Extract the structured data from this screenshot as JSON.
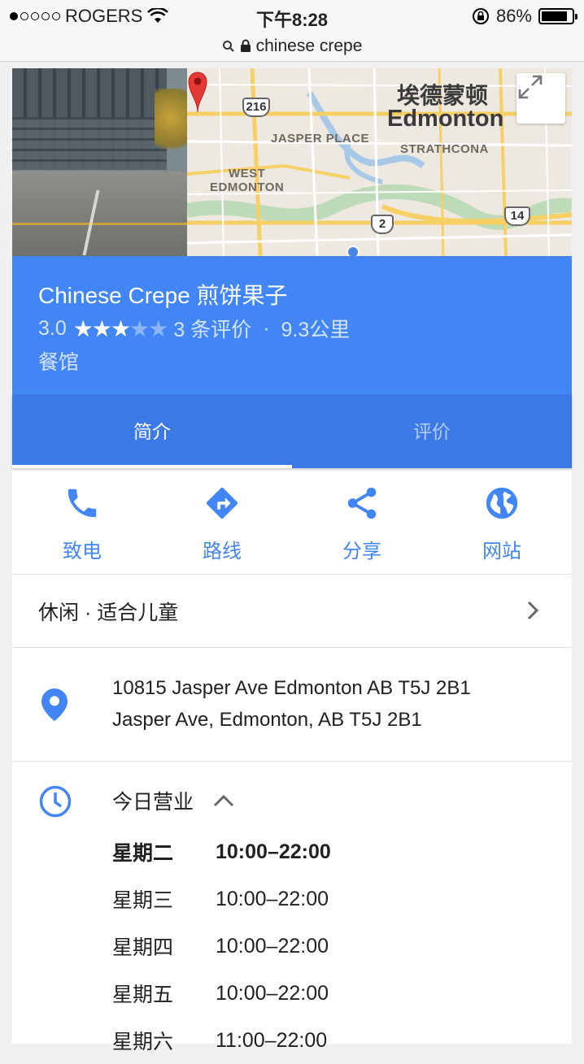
{
  "status_bar": {
    "carrier": "ROGERS",
    "time": "下午8:28",
    "battery": "86%",
    "battery_level": 0.86,
    "signal_bars_filled": 1,
    "signal_bars_total": 5
  },
  "url_bar": {
    "url": "chinese crepe"
  },
  "map": {
    "city_cn": "埃德蒙顿",
    "city": "Edmonton",
    "labels": {
      "jasper_place": "JASPER PLACE",
      "strathcona": "STRATHCONA",
      "west_edmonton": "WEST\nEDMONTON"
    },
    "shields": {
      "h216": "216",
      "h2": "2",
      "h14": "14"
    }
  },
  "place": {
    "name": "Chinese Crepe 煎饼果子",
    "rating": "3.0",
    "rating_value": 3,
    "reviews": "3 条评价",
    "separator": "·",
    "distance": "9.3公里",
    "category": "餐馆"
  },
  "tabs": {
    "overview": "简介",
    "reviews": "评价"
  },
  "actions": {
    "call": "致电",
    "directions": "路线",
    "share": "分享",
    "website": "网站"
  },
  "features": "休闲 · 适合儿童",
  "address": {
    "line1": "10815 Jasper Ave Edmonton AB T5J 2B1",
    "line2": "Jasper Ave, Edmonton, AB T5J 2B1"
  },
  "hours": {
    "title": "今日营业",
    "rows": [
      {
        "day": "星期二",
        "time": "10:00–22:00"
      },
      {
        "day": "星期三",
        "time": "10:00–22:00"
      },
      {
        "day": "星期四",
        "time": "10:00–22:00"
      },
      {
        "day": "星期五",
        "time": "10:00–22:00"
      },
      {
        "day": "星期六",
        "time": "11:00–22:00"
      }
    ]
  },
  "colors": {
    "accent": "#4285f4",
    "tab_bar": "#3b7ae6",
    "pin": "#e53935"
  }
}
